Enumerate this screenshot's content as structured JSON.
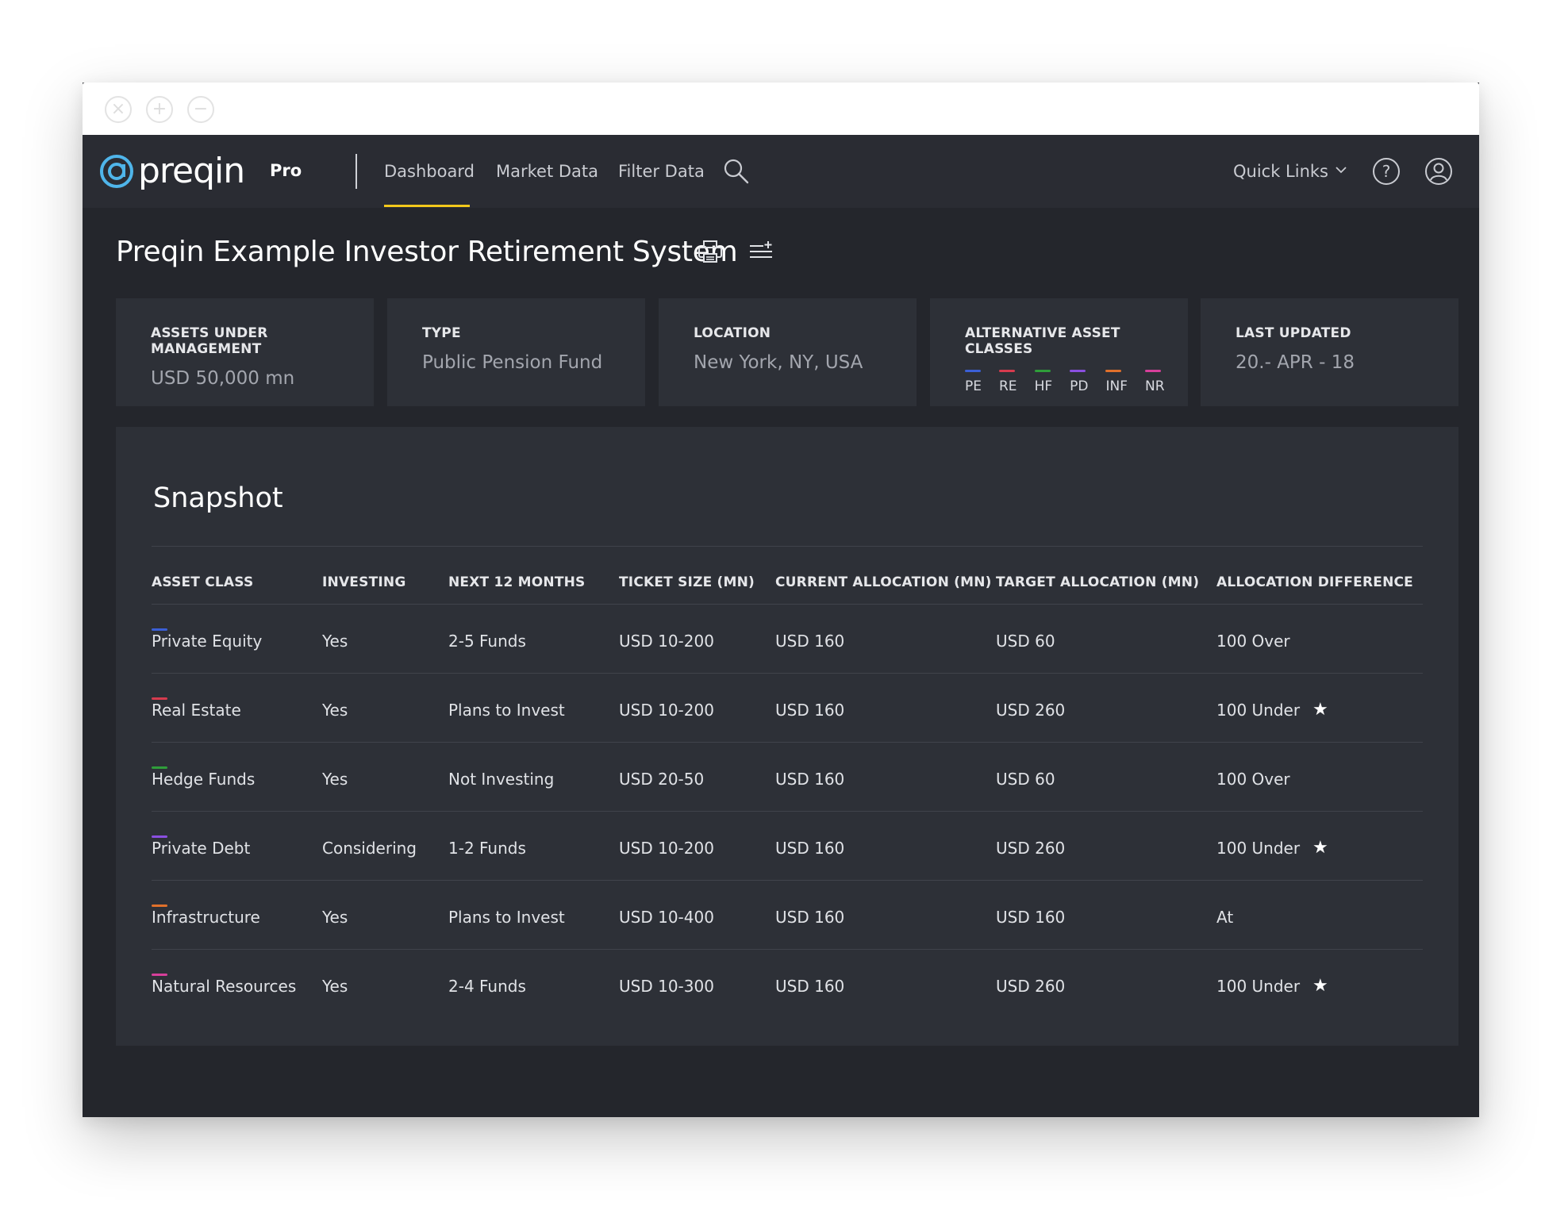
{
  "window": {
    "controls": [
      "close-icon",
      "plus-icon",
      "minus-icon"
    ]
  },
  "nav": {
    "logo_text": "preqin",
    "pro_label": "Pro",
    "links": [
      "Dashboard",
      "Market Data",
      "Filter Data"
    ],
    "active_link": "Dashboard",
    "search_icon": "search-icon",
    "quick_links_label": "Quick Links",
    "help_icon": "help-icon",
    "user_icon": "user-icon",
    "accent_color": "#f2c81b"
  },
  "page": {
    "title": "Preqin Example Investor Retirement System",
    "icons": [
      "print-icon",
      "add-to-list-icon"
    ]
  },
  "cards": {
    "aum": {
      "label": "ASSETS UNDER MANAGEMENT",
      "value": "USD 50,000 mn"
    },
    "type": {
      "label": "TYPE",
      "value": "Public Pension Fund"
    },
    "location": {
      "label": "LOCATION",
      "value": "New York, NY, USA"
    },
    "aac": {
      "label": "ALTERNATIVE ASSET CLASSES",
      "items": [
        {
          "code": "PE",
          "color": "#3b5fd6"
        },
        {
          "code": "RE",
          "color": "#d63b4e"
        },
        {
          "code": "HF",
          "color": "#2f9e3a"
        },
        {
          "code": "PD",
          "color": "#8a4fe0"
        },
        {
          "code": "INF",
          "color": "#e0702b"
        },
        {
          "code": "NR",
          "color": "#d63f9a"
        }
      ]
    },
    "updated": {
      "label": "LAST UPDATED",
      "value": "20.- APR - 18"
    }
  },
  "snapshot": {
    "title": "Snapshot",
    "headers": [
      "ASSET CLASS",
      "INVESTING",
      "NEXT 12 MONTHS",
      "TICKET SIZE (MN)",
      "CURRENT ALLOCATION (MN)",
      "TARGET ALLOCATION (MN)",
      "ALLOCATION DIFFERENCE"
    ],
    "rows": [
      {
        "asset_class": "Private Equity",
        "color": "#3b5fd6",
        "investing": "Yes",
        "next12": "2-5 Funds",
        "ticket": "USD 10-200",
        "current": "USD 160",
        "target": "USD 60",
        "difference": "100 Over",
        "starred": false
      },
      {
        "asset_class": "Real Estate",
        "color": "#d63b4e",
        "investing": "Yes",
        "next12": "Plans to Invest",
        "ticket": "USD 10-200",
        "current": "USD 160",
        "target": "USD 260",
        "difference": "100 Under",
        "starred": true
      },
      {
        "asset_class": "Hedge Funds",
        "color": "#2f9e3a",
        "investing": "Yes",
        "next12": "Not Investing",
        "ticket": "USD 20-50",
        "current": "USD 160",
        "target": "USD 60",
        "difference": "100 Over",
        "starred": false
      },
      {
        "asset_class": "Private Debt",
        "color": "#8a4fe0",
        "investing": "Considering",
        "next12": "1-2 Funds",
        "ticket": "USD 10-200",
        "current": "USD 160",
        "target": "USD 260",
        "difference": "100 Under",
        "starred": true
      },
      {
        "asset_class": "Infrastructure",
        "color": "#e0702b",
        "investing": "Yes",
        "next12": "Plans to Invest",
        "ticket": "USD 10-400",
        "current": "USD 160",
        "target": "USD 160",
        "difference": "At",
        "starred": false
      },
      {
        "asset_class": "Natural Resources",
        "color": "#d63f9a",
        "investing": "Yes",
        "next12": "2-4 Funds",
        "ticket": "USD 10-300",
        "current": "USD 160",
        "target": "USD 260",
        "difference": "100 Under",
        "starred": true
      }
    ]
  }
}
